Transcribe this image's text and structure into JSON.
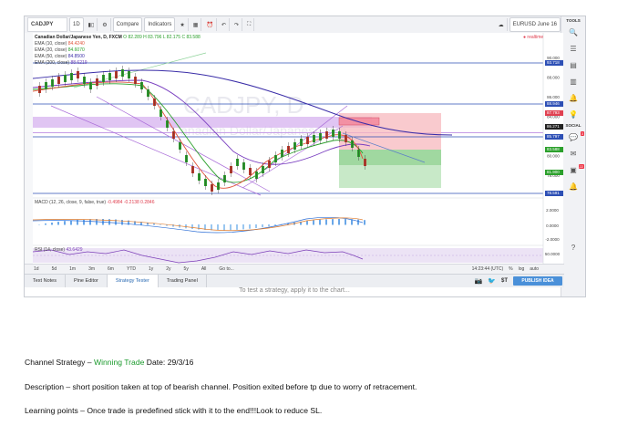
{
  "toolbar": {
    "symbol": "CADJPY",
    "interval": "1D",
    "compare": "Compare",
    "indicators": "Indicators",
    "right_box": "EURUSD June 16"
  },
  "chart": {
    "title": "Canadian Dollar/Japanese Yen, D, FXCM",
    "ohlc": "O 82.289 H 83.796 L 82.175 C 83.588",
    "realtime": "realtime",
    "watermark_symbol": "CADJPY, D",
    "watermark_name": "Canadian Dollar/Japanese Yen",
    "ema": [
      {
        "label": "EMA (10, close)",
        "value": "84.4240",
        "color": "#e0523a"
      },
      {
        "label": "EMA (20, close)",
        "value": "84.6070",
        "color": "#2ca02c"
      },
      {
        "label": "EMA (50, close)",
        "value": "84.8500",
        "color": "#3b2ea8"
      },
      {
        "label": "EMA (200, close)",
        "value": "88.6219",
        "color": "#6a3bb3"
      }
    ],
    "price_axis": [
      "90.000",
      "88.000",
      "86.000",
      "84.000",
      "82.000",
      "80.000",
      "78.000"
    ],
    "price_markers": [
      {
        "value": "93.718",
        "color": "#2d4fb5"
      },
      {
        "value": "88.946",
        "color": "#2d4fb5"
      },
      {
        "value": "87.793",
        "color": "#e04050"
      },
      {
        "value": "86.271",
        "color": "#222222"
      },
      {
        "value": "85.797",
        "color": "#2d4fb5"
      },
      {
        "value": "83.588",
        "color": "#2ca02c"
      },
      {
        "value": "81.900",
        "color": "#2ca02c"
      },
      {
        "value": "78.591",
        "color": "#2d4fb5"
      }
    ],
    "time_axis": [
      "Oct",
      "Nov",
      "Dec",
      "2016",
      "Feb",
      "Mar",
      "Apr",
      "May",
      "Jun",
      "Jul",
      "Aug",
      "Sep"
    ],
    "macd": {
      "label": "MACD (12, 26, close, 9, false, true)",
      "values": "-0.4984  -0.2138  0.2846",
      "axis": [
        "2.0000",
        "0.0000",
        "-2.0000"
      ]
    },
    "rsi": {
      "label": "RSI (14, close)",
      "value": "43.6429",
      "axis": [
        "50.0000",
        "25.0000"
      ]
    }
  },
  "range_buttons": [
    "1d",
    "5d",
    "1m",
    "3m",
    "6m",
    "YTD",
    "1y",
    "2y",
    "5y",
    "All",
    "Go to..."
  ],
  "bottom_right": [
    "14:23:44 (UTC)",
    "%",
    "log",
    "auto"
  ],
  "tabs": [
    "Text Notes",
    "Pine Editor",
    "Strategy Tester",
    "Trading Panel"
  ],
  "publish": "PUBLISH IDEA",
  "strategy_msg": "To test a strategy, apply it to the chart...",
  "right_tools": {
    "top": "TOOLS",
    "social": "SOCIAL"
  },
  "doc": {
    "line1_prefix": "Channel  Strategy – ",
    "line1_green": "Winning Trade",
    "line1_suffix": "  Date: 29/3/16",
    "line2": "Description –  short position taken at top of bearish channel. Position exited before tp due to worry of retracement.",
    "line3": "Learning points –  Once trade  is predefined stick with it to the end!!!Look to reduce SL."
  }
}
